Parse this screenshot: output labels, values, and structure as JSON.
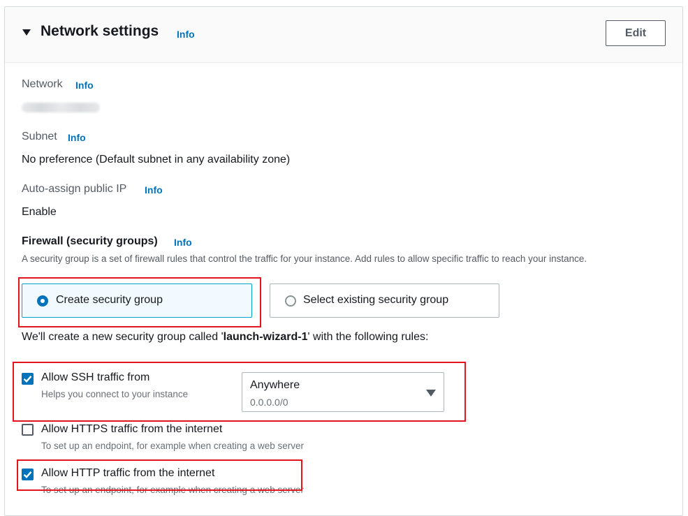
{
  "section": {
    "title": "Network settings",
    "info": "Info",
    "edit_label": "Edit"
  },
  "network": {
    "label": "Network",
    "info": "Info"
  },
  "subnet": {
    "label": "Subnet",
    "info": "Info",
    "value": "No preference (Default subnet in any availability zone)"
  },
  "auto_ip": {
    "label": "Auto-assign public IP",
    "info": "Info",
    "value": "Enable"
  },
  "firewall": {
    "label": "Firewall (security groups)",
    "info": "Info",
    "description": "A security group is a set of firewall rules that control the traffic for your instance. Add rules to allow specific traffic to reach your instance.",
    "options": [
      {
        "label": "Create security group",
        "selected": true
      },
      {
        "label": "Select existing security group",
        "selected": false
      }
    ],
    "notice_prefix": "We'll create a new security group called '",
    "notice_name": "launch-wizard-1",
    "notice_suffix": "' with the following rules:"
  },
  "rules": [
    {
      "label": "Allow SSH traffic from",
      "description": "Helps you connect to your instance",
      "checked": true
    },
    {
      "label": "Allow HTTPS traffic from the internet",
      "description": "To set up an endpoint, for example when creating a web server",
      "checked": false
    },
    {
      "label": "Allow HTTP traffic from the internet",
      "description": "To set up an endpoint, for example when creating a web server",
      "checked": true
    }
  ],
  "ssh_source": {
    "value": "Anywhere",
    "sub": "0.0.0.0/0"
  },
  "colors": {
    "accent": "#0073bb",
    "highlight": "#e3141b",
    "selected_bg": "#f1faff"
  }
}
